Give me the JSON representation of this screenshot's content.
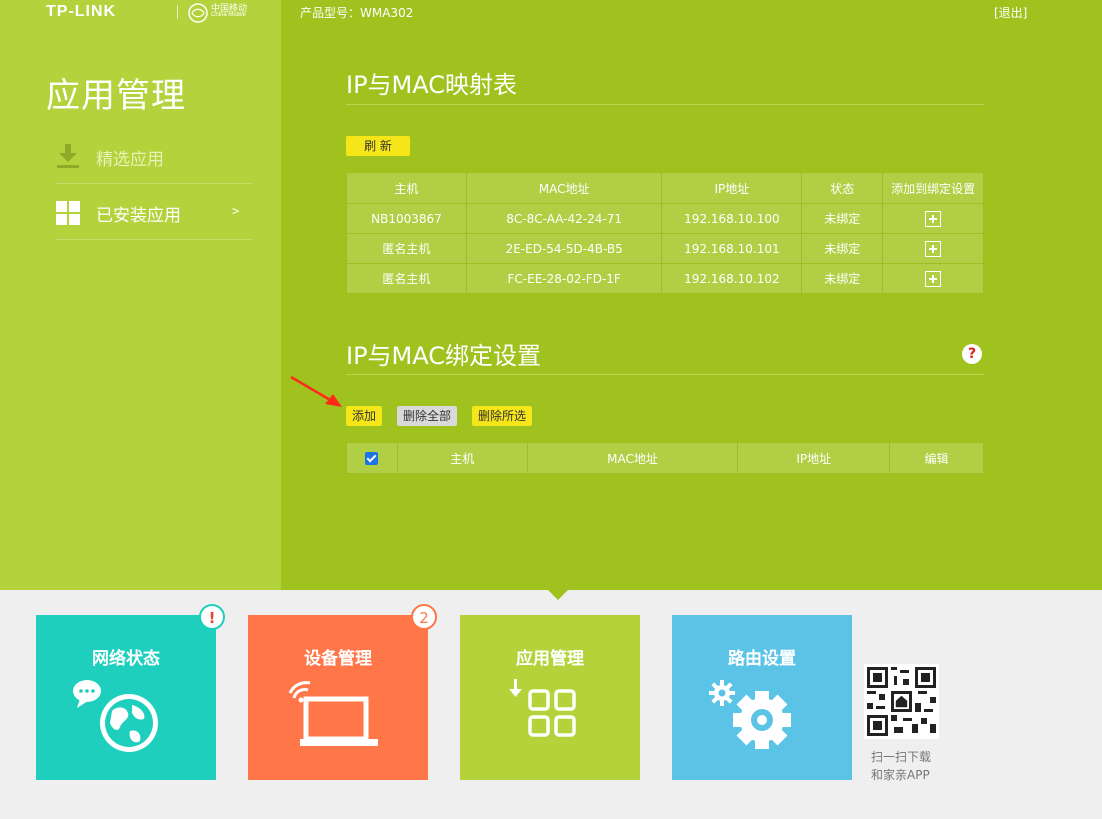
{
  "header": {
    "brand": "TP-LINK",
    "partner_cn": "中国移动",
    "partner_en": "China Mobile",
    "model": "产品型号：WMA302",
    "logout": "[退出]"
  },
  "sidebar": {
    "title": "应用管理",
    "items": [
      {
        "label": "精选应用",
        "icon": "download-icon",
        "active": false
      },
      {
        "label": "已安装应用",
        "icon": "grid-icon",
        "active": true,
        "chevron": ">"
      }
    ]
  },
  "mapping": {
    "title": "IP与MAC映射表",
    "refresh_label": "刷 新",
    "columns": [
      "主机",
      "MAC地址",
      "IP地址",
      "状态",
      "添加到绑定设置"
    ],
    "rows": [
      {
        "host": "NB1003867",
        "mac": "8C-8C-AA-42-24-71",
        "ip": "192.168.10.100",
        "status": "未绑定"
      },
      {
        "host": "匿名主机",
        "mac": "2E-ED-54-5D-4B-B5",
        "ip": "192.168.10.101",
        "status": "未绑定"
      },
      {
        "host": "匿名主机",
        "mac": "FC-EE-28-02-FD-1F",
        "ip": "192.168.10.102",
        "status": "未绑定"
      }
    ]
  },
  "binding": {
    "title": "IP与MAC绑定设置",
    "help": "?",
    "add_label": "添加",
    "delete_all_label": "删除全部",
    "delete_selected_label": "删除所选",
    "columns": [
      "主机",
      "MAC地址",
      "IP地址",
      "编辑"
    ],
    "select_all_checked": true
  },
  "tiles": [
    {
      "label": "网络状态",
      "badge": "!",
      "color": "#1ecfbe"
    },
    {
      "label": "设备管理",
      "badge": "2",
      "color": "#ff7649"
    },
    {
      "label": "应用管理",
      "color": "#b5d23b",
      "active": true
    },
    {
      "label": "路由设置",
      "color": "#5bc4e6"
    }
  ],
  "qr": {
    "line1": "扫一扫下载",
    "line2": "和家亲APP"
  },
  "colors": {
    "main_bg": "#a0c21f",
    "sidebar_bg": "#b3d23c",
    "button_yellow": "#f5e61a",
    "arrow_red": "#ff2a1a"
  }
}
